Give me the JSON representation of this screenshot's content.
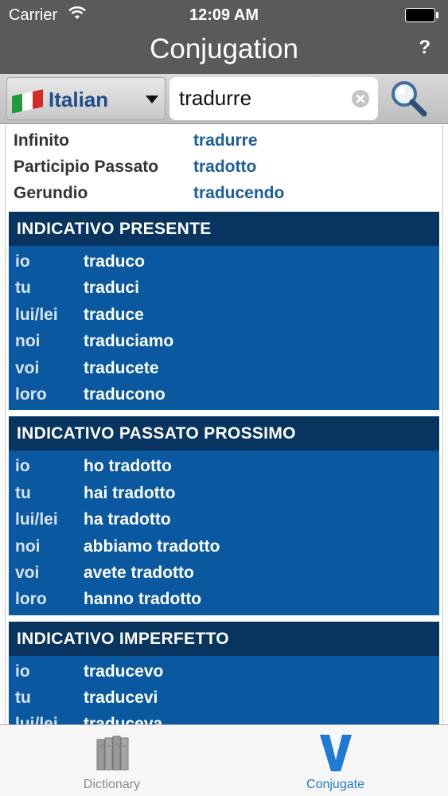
{
  "status_bar": {
    "carrier": "Carrier",
    "time": "12:09 AM"
  },
  "nav": {
    "title": "Conjugation",
    "help_label": "?"
  },
  "toolbar": {
    "language": "Italian",
    "search_value": "tradurre"
  },
  "basic_forms": [
    {
      "label": "Infinito",
      "value": "tradurre"
    },
    {
      "label": "Participio Passato",
      "value": "tradotto"
    },
    {
      "label": "Gerundio",
      "value": "traducendo"
    }
  ],
  "sections": [
    {
      "title": "INDICATIVO PRESENTE",
      "rows": [
        {
          "pronoun": "io",
          "form": "traduco"
        },
        {
          "pronoun": "tu",
          "form": "traduci"
        },
        {
          "pronoun": "lui/lei",
          "form": "traduce"
        },
        {
          "pronoun": "noi",
          "form": "traduciamo"
        },
        {
          "pronoun": "voi",
          "form": "traducete"
        },
        {
          "pronoun": "loro",
          "form": "traducono"
        }
      ]
    },
    {
      "title": "INDICATIVO PASSATO PROSSIMO",
      "rows": [
        {
          "pronoun": "io",
          "form": "ho tradotto"
        },
        {
          "pronoun": "tu",
          "form": "hai tradotto"
        },
        {
          "pronoun": "lui/lei",
          "form": "ha tradotto"
        },
        {
          "pronoun": "noi",
          "form": "abbiamo tradotto"
        },
        {
          "pronoun": "voi",
          "form": "avete tradotto"
        },
        {
          "pronoun": "loro",
          "form": "hanno tradotto"
        }
      ]
    },
    {
      "title": "INDICATIVO IMPERFETTO",
      "rows": [
        {
          "pronoun": "io",
          "form": "traducevo"
        },
        {
          "pronoun": "tu",
          "form": "traducevi"
        },
        {
          "pronoun": "lui/lei",
          "form": "traduceva"
        }
      ]
    }
  ],
  "tabs": [
    {
      "label": "Dictionary",
      "icon": "books-icon",
      "selected": false
    },
    {
      "label": "Conjugate",
      "icon": "v-icon",
      "selected": true
    }
  ],
  "colors": {
    "header_bg": "#5a5a5a",
    "section_header": "#083460",
    "section_body": "#0a58a0",
    "value_blue": "#1a5e9a",
    "tab_active": "#1f7ad6"
  }
}
